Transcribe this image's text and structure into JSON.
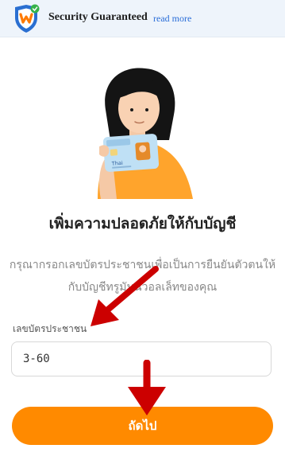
{
  "banner": {
    "title": "Security Guaranteed",
    "link": "read more"
  },
  "main": {
    "title": "เพิ่มความปลอดภัยให้กับบัญชี",
    "description": "กรุณากรอกเลขบัตรประชาชนเพื่อเป็นการยืนยันตัวตนให้กับบัญชีทรูมันนี่วอลเล็ทของคุณ",
    "field_label": "เลขบัตรประชาชน",
    "input_value": "3-60",
    "button_label": "ถัดไป"
  },
  "card": {
    "brand": "Thai"
  },
  "colors": {
    "accent": "#ff8a00",
    "arrow": "#cc0000",
    "link": "#2b6ed8"
  }
}
